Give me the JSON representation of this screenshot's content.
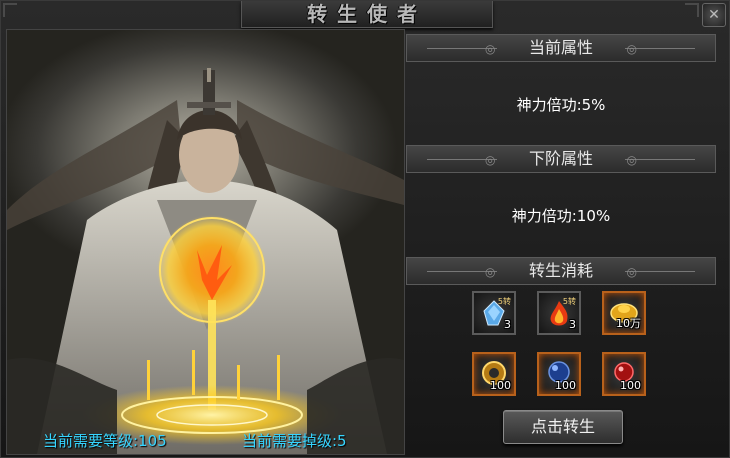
{
  "window": {
    "title": "转生使者",
    "close_icon": "close-icon"
  },
  "art": {
    "requirement_level": "当前需要等级:105",
    "requirement_drop": "当前需要掉级:5"
  },
  "sections": {
    "current": {
      "title": "当前属性",
      "attribute": "神力倍功:5%"
    },
    "next": {
      "title": "下阶属性",
      "attribute": "神力倍功:10%"
    },
    "cost": {
      "title": "转生消耗"
    }
  },
  "cost_items": [
    {
      "icon": "blue-gem-icon",
      "count": "3",
      "level": "5转"
    },
    {
      "icon": "red-flame-gem-icon",
      "count": "3",
      "level": "5转"
    },
    {
      "icon": "gold-ingot-icon",
      "count": "10万",
      "level": ""
    },
    {
      "icon": "gold-medal-icon",
      "count": "100",
      "level": ""
    },
    {
      "icon": "blue-orb-icon",
      "count": "100",
      "level": ""
    },
    {
      "icon": "red-orb-icon",
      "count": "100",
      "level": ""
    }
  ],
  "buttons": {
    "rebirth": "点击转生"
  },
  "colors": {
    "requirement_text": "#36d5ff",
    "rare_border": "#b8611b"
  }
}
